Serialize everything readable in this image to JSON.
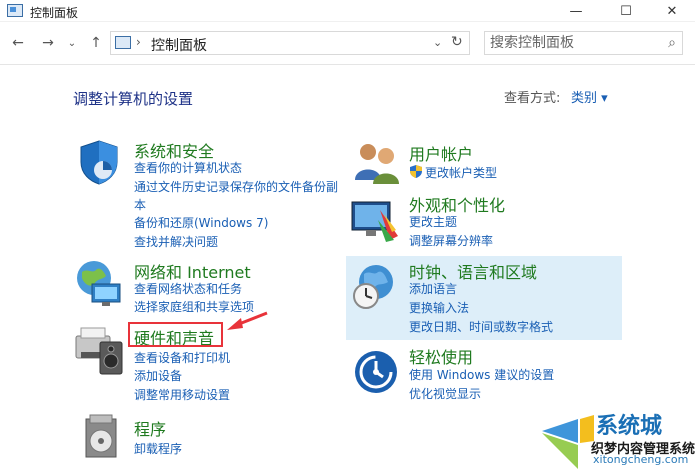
{
  "window": {
    "title": "控制面板",
    "min_glyph": "—",
    "max_glyph": "☐",
    "close_glyph": "✕"
  },
  "nav": {
    "back_glyph": "←",
    "forward_glyph": "→",
    "history_glyph": "⌄",
    "up_glyph": "↑",
    "breadcrumb_sep": "›",
    "address": "控制面板",
    "address_dropdown_glyph": "⌄",
    "refresh_glyph": "↻",
    "search_placeholder": "搜索控制面板",
    "search_glyph": "⌕"
  },
  "main": {
    "heading": "调整计算机的设置",
    "view_by_label": "查看方式:",
    "view_by_value": "类别 ▾"
  },
  "categories": {
    "system": {
      "title": "系统和安全",
      "links": [
        "查看你的计算机状态",
        "通过文件历史记录保存你的文件备份副",
        "本",
        "备份和还原(Windows 7)",
        "查找并解决问题"
      ]
    },
    "network": {
      "title": "网络和 Internet",
      "links": [
        "查看网络状态和任务",
        "选择家庭组和共享选项"
      ]
    },
    "hardware": {
      "title": "硬件和声音",
      "links": [
        "查看设备和打印机",
        "添加设备",
        "调整常用移动设置"
      ]
    },
    "programs": {
      "title": "程序",
      "links": [
        "卸载程序"
      ]
    },
    "user": {
      "title": "用户帐户",
      "links": [
        "更改帐户类型"
      ]
    },
    "appearance": {
      "title": "外观和个性化",
      "links": [
        "更改主题",
        "调整屏幕分辨率"
      ]
    },
    "clock": {
      "title": "时钟、语言和区域",
      "links": [
        "添加语言",
        "更换输入法",
        "更改日期、时间或数字格式"
      ]
    },
    "ease": {
      "title": "轻松使用",
      "links": [
        "使用 Windows 建议的设置",
        "优化视觉显示"
      ]
    }
  },
  "watermark": {
    "line1": "系统城",
    "line2": "织梦内容管理系统",
    "line3": "xitongcheng.com"
  },
  "colors": {
    "heading": "#1e3287",
    "category_title": "#1f7a1f",
    "link": "#1a5fb4",
    "highlight": "#ddeef9",
    "annotation": "#e8333a"
  }
}
